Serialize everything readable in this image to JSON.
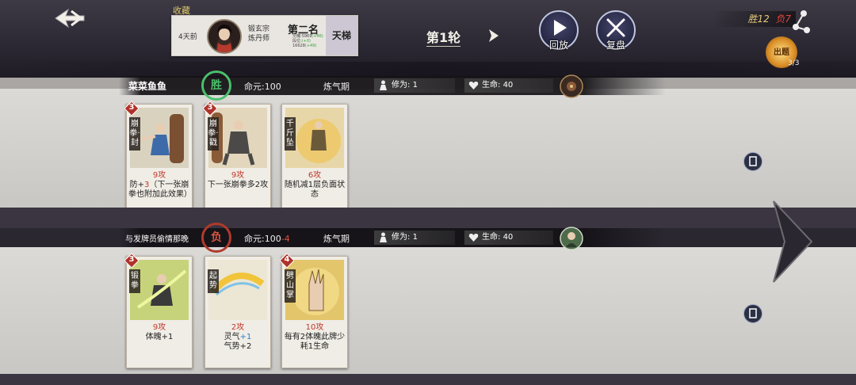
{
  "header": {
    "favorite_label": "收藏",
    "record": {
      "time": "4天前",
      "sect": "锻玄宗",
      "role": "炼丹师",
      "rank": "第二名",
      "stat1_label": "灵魄:",
      "stat1_value": "5969",
      "stat1_delta": "(+46)",
      "stat2_label": "段位:",
      "stat2_value": "",
      "stat2_delta": "(+0)",
      "stat3_value": "16628",
      "stat3_delta": "(+49)",
      "mode": "天梯"
    },
    "round_label": "第1轮",
    "replay_label": "回放",
    "review_label": "复盘",
    "score_win": "胜12",
    "score_lose": "负7",
    "qi_label": "出题",
    "qi_count": "3/3"
  },
  "players": [
    {
      "name": "菜菜鱼鱼",
      "result": "胜",
      "hp_label": "命元:",
      "hp": "100",
      "hp_change": "",
      "realm": "炼气期",
      "cultivation_label": "修为:",
      "cultivation": "1",
      "life_label": "生命:",
      "life": "40",
      "cards": [
        {
          "name": "崩拳·封",
          "level": "3",
          "atk": "9攻",
          "effect_pre": "防+",
          "effect_num": "3",
          "effect_post": "（下一张崩拳也附加此效果）"
        },
        {
          "name": "崩拳·戳",
          "level": "3",
          "atk": "9攻",
          "effect_pre": "下一张崩拳多2攻",
          "effect_num": "",
          "effect_post": ""
        },
        {
          "name": "千斤坠",
          "level": "",
          "atk": "6攻",
          "effect_pre": "随机减1层负面状态",
          "effect_num": "",
          "effect_post": ""
        }
      ]
    },
    {
      "name": "与发牌员偷情那晚",
      "result": "负",
      "hp_label": "命元:",
      "hp": "100",
      "hp_change": "-4",
      "realm": "炼气期",
      "cultivation_label": "修为:",
      "cultivation": "1",
      "life_label": "生命:",
      "life": "40",
      "cards": [
        {
          "name": "锻拳",
          "level": "3",
          "atk": "9攻",
          "effect_pre": "体魄+1",
          "effect_num": "",
          "effect_post": ""
        },
        {
          "name": "起势",
          "level": "",
          "atk": "2攻",
          "effect_pre": "灵气",
          "effect_num": "+1",
          "effect_post": "气势+2"
        },
        {
          "name": "劈山掌",
          "level": "4",
          "atk": "10攻",
          "effect_pre": "每有2体魄此牌少耗1生命",
          "effect_num": "",
          "effect_post": ""
        }
      ]
    }
  ],
  "colors": {
    "win": "#4bbf6b",
    "lose": "#d8553f",
    "attack": "#c0392b",
    "gold": "#e7c97a"
  }
}
